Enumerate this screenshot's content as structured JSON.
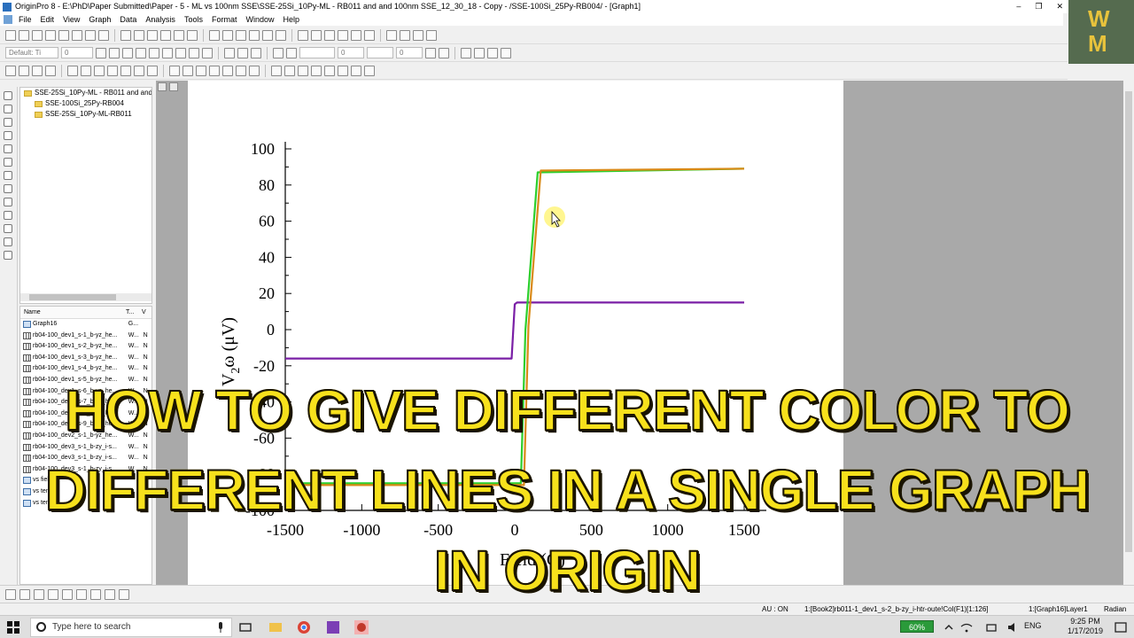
{
  "window": {
    "title": "OriginPro 8 - E:\\PhD\\Paper Submitted\\Paper - 5 - ML vs 100nm SSE\\SSE-25Si_10Py-ML - RB011 and and 100nm SSE_12_30_18 - Copy - /SSE-100Si_25Py-RB004/ - [Graph1]",
    "controls": [
      "–",
      "❐",
      "✕"
    ]
  },
  "menu": [
    "File",
    "Edit",
    "View",
    "Graph",
    "Data",
    "Analysis",
    "Tools",
    "Format",
    "Window",
    "Help"
  ],
  "toolbar": {
    "font_name": "Default: Ti",
    "font_size": "0",
    "line_width": "0",
    "fill_value": "0"
  },
  "logo": {
    "line1": "W",
    "line2": "M"
  },
  "project_tree": [
    {
      "label": "SSE-25Si_10Py-ML - RB011 and and 1",
      "indent": 0
    },
    {
      "label": "SSE-100Si_25Py-RB004",
      "indent": 1
    },
    {
      "label": "SSE-25Si_10Py-ML-RB011",
      "indent": 1
    }
  ],
  "file_list": {
    "headers": [
      "Name",
      "T...",
      "V"
    ],
    "rows": [
      {
        "name": "Graph16",
        "type": "G...",
        "v": "",
        "kind": "graph"
      },
      {
        "name": "rb04-100_dev1_s-1_b-yz_he...",
        "type": "W...",
        "v": "N",
        "kind": "book"
      },
      {
        "name": "rb04-100_dev1_s-2_b-yz_he...",
        "type": "W...",
        "v": "N",
        "kind": "book"
      },
      {
        "name": "rb04-100_dev1_s-3_b-yz_he...",
        "type": "W...",
        "v": "N",
        "kind": "book"
      },
      {
        "name": "rb04-100_dev1_s-4_b-yz_he...",
        "type": "W...",
        "v": "N",
        "kind": "book"
      },
      {
        "name": "rb04-100_dev1_s-5_b-yz_he...",
        "type": "W...",
        "v": "N",
        "kind": "book"
      },
      {
        "name": "rb04-100_dev1_s-6_b-yz_he...",
        "type": "W...",
        "v": "N",
        "kind": "book"
      },
      {
        "name": "rb04-100_dev1_s-7_b-yz_he...",
        "type": "W...",
        "v": "N",
        "kind": "book"
      },
      {
        "name": "rb04-100_dev1_s-8_b-yz_he...",
        "type": "W...",
        "v": "N",
        "kind": "book"
      },
      {
        "name": "rb04-100_dev1_s-9_b-yz_he...",
        "type": "W...",
        "v": "N",
        "kind": "book"
      },
      {
        "name": "rb04-100_dev2_s-1_b-yz_he...",
        "type": "W...",
        "v": "N",
        "kind": "book"
      },
      {
        "name": "rb04-100_dev3_s-1_b-zy_i-s...",
        "type": "W...",
        "v": "N",
        "kind": "book"
      },
      {
        "name": "rb04-100_dev3_s-1_b-zy_i-s...",
        "type": "W...",
        "v": "N",
        "kind": "book"
      },
      {
        "name": "rb04-100_dev3_s-1_b-zy_i-s...",
        "type": "W...",
        "v": "N",
        "kind": "book"
      },
      {
        "name": "vs field",
        "type": "",
        "v": "",
        "kind": "graph"
      },
      {
        "name": "vs temp",
        "type": "",
        "v": "",
        "kind": "graph"
      },
      {
        "name": "vs temp",
        "type": "",
        "v": "N",
        "kind": "graph"
      }
    ]
  },
  "chart_data": {
    "type": "line",
    "xlabel": "Field (G)",
    "ylabel": "V2ω (μV)",
    "ylabel_parts": {
      "main": "V",
      "sub": "2",
      "rest": "ω (μV)"
    },
    "xlim": [
      -1500,
      1500
    ],
    "ylim": [
      -100,
      100
    ],
    "xticks": [
      -1500,
      -1000,
      -500,
      0,
      500,
      1000,
      1500
    ],
    "yticks": [
      100,
      80,
      60,
      40,
      20,
      0,
      -20,
      -40,
      -60,
      -80,
      -100
    ],
    "grid": false,
    "series": [
      {
        "color": "#7a1fa6",
        "x": [
          -1500,
          -20,
          0,
          15,
          1500
        ],
        "y": [
          -16,
          -16,
          14,
          15,
          15
        ]
      },
      {
        "color": "#2ccf2c",
        "x": [
          -1500,
          40,
          70,
          150,
          1500
        ],
        "y": [
          -85,
          -85,
          0,
          87,
          89
        ]
      },
      {
        "color": "#d98a17",
        "x": [
          -1500,
          60,
          90,
          170,
          1500
        ],
        "y": [
          -86,
          -86,
          2,
          88,
          89
        ]
      }
    ]
  },
  "overlay": {
    "line1": "HOW TO GIVE DIFFERENT COLOR TO",
    "line2": "DIFFERENT LINES IN A SINGLE GRAPH",
    "line3": "IN ORIGIN"
  },
  "status": {
    "au": "AU : ON",
    "selection": "1:[Book2]rb011-1_dev1_s-2_b-zy_i-htr-oute!Col(F1)[1:126]",
    "layer": "1:[Graph16]Layer1",
    "units": "Radian"
  },
  "taskbar": {
    "search_placeholder": "Type here to search",
    "battery": "60%",
    "language": "ENG",
    "time": "9:25 PM",
    "date": "1/17/2019"
  }
}
